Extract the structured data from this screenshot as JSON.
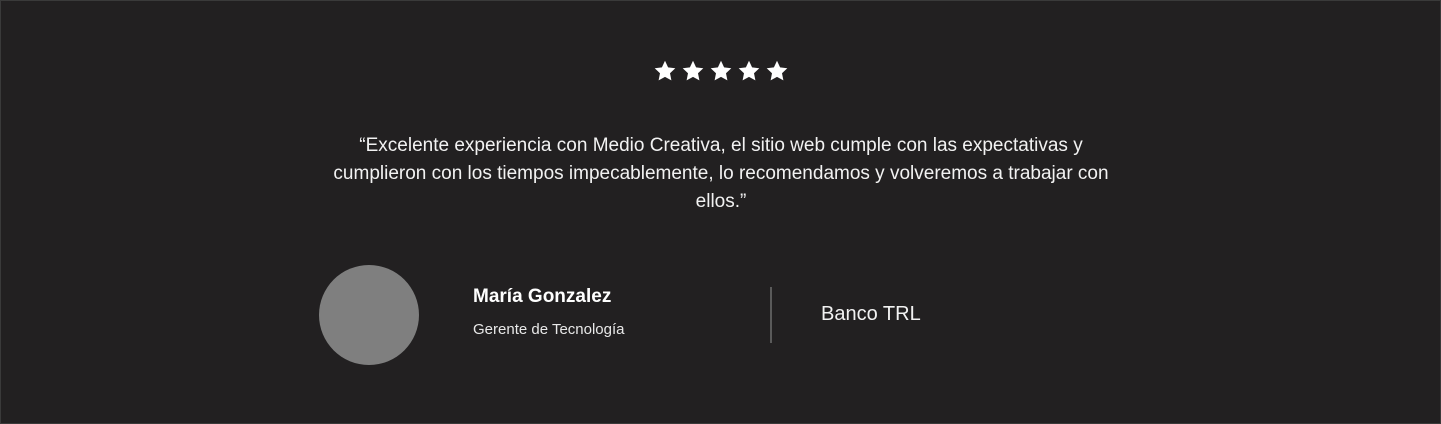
{
  "testimonial": {
    "rating": 5,
    "rating_max": 5,
    "star_icons": [
      "star-icon",
      "star-icon",
      "star-icon",
      "star-icon",
      "star-icon"
    ],
    "quote": "“Excelente experiencia con Medio Creativa, el sitio web cumple con las expectativas y cumplieron con los tiempos impecablemente, lo recomendamos y volveremos a trabajar con ellos.”",
    "author": {
      "name": "María Gonzalez",
      "role": "Gerente de Tecnología",
      "avatar_color": "#7f7f7f"
    },
    "company": "Banco TRL"
  },
  "colors": {
    "background": "#222021",
    "text": "#ffffff",
    "divider": "#5a5a5a"
  }
}
